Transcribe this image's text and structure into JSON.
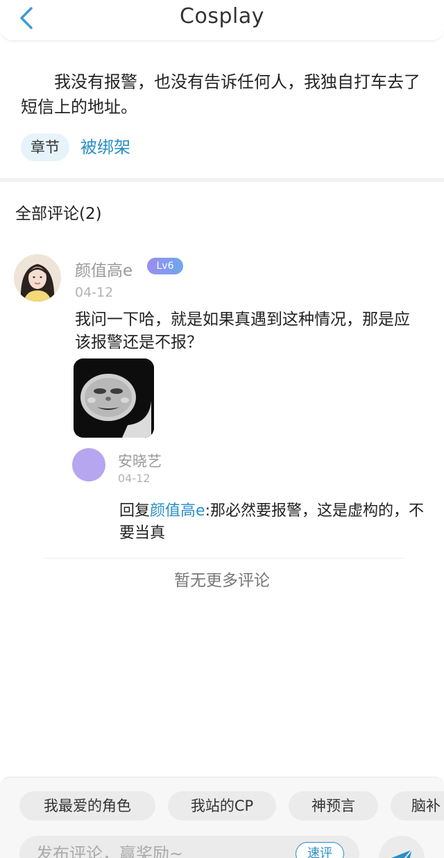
{
  "header": {
    "title": "Cosplay",
    "back_icon": "chevron-left-icon"
  },
  "excerpt": {
    "text": "我没有报警，也没有告诉任何人，我独自打车去了短信上的地址。"
  },
  "chapter": {
    "tag_label": "章节",
    "name": "被绑架"
  },
  "comments": {
    "title": "全部评论(2)",
    "items": [
      {
        "username": "颜值高e",
        "level": "Lv6",
        "date": "04-12",
        "text": "我问一下哈，就是如果真遇到这种情况，那是应该报警还是不报？",
        "has_sticker": true,
        "reply": {
          "username": "安晓艺",
          "date": "04-12",
          "prefix": "回复",
          "mention": "颜值高e",
          "text": ":那必然要报警，这是虚构的，不要当真"
        }
      }
    ],
    "no_more": "暂无更多评论"
  },
  "bottom_bar": {
    "chips": [
      "我最爱的角色",
      "我站的CP",
      "神预言",
      "脑补"
    ],
    "input_placeholder": "发布评论，赢奖励~",
    "quick_review_label": "速评",
    "send_icon": "send-plane-icon"
  },
  "colors": {
    "accent": "#2a8fc7",
    "level_badge_start": "#9b8cf0",
    "level_badge_end": "#6fa6ee",
    "reply_avatar": "#b6a6f0",
    "tag_bg": "#e6f3fa"
  }
}
